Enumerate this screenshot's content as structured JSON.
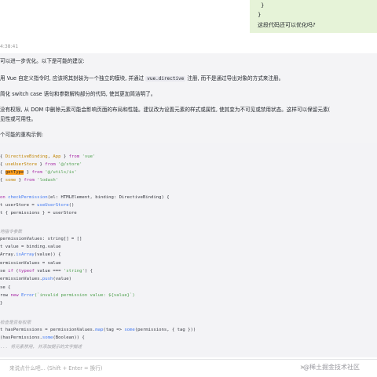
{
  "top_bubble": {
    "lines": [
      "}",
      "}",
      "这段代码还可以优化吗?"
    ]
  },
  "timestamp": "4:38:41",
  "answer": {
    "p1": "可以进一步优化。以下是可能的建议:",
    "p2_pre": "用 Vue 自定义指令时, 应该将其封装为一个独立的模块, 并通过 ",
    "p2_code": "vue.directive",
    "p2_post": " 注册, 而不是通过导出对象的方式来注册。",
    "p3": "简化 switch case 语句和参数解构部分的代码, 使其更加简洁明了。",
    "p4a": "没有权限, 从 DOM 中删除元素可能会影响页面的布局和性能。建议改为设置元素的样式或属性, 使其变为不可见或禁用状态。这样可以保留元素(",
    "p4b": "见性或可用性。",
    "p5": "个可能的重构示例:"
  },
  "code": {
    "l1_pre": "{ ",
    "l1_a": "DirectiveBinding",
    "l1_sep": ", ",
    "l1_b": "App",
    "l1_mid": " } ",
    "l1_kw": "from",
    "l1_str": " 'vue'",
    "l2_pre": "{ ",
    "l2_a": "useUserStore",
    "l2_mid": " } ",
    "l2_kw": "from",
    "l2_str": " '@/store'",
    "l3_pre": "{ ",
    "l3_a": "getType",
    "l3_mid": " } ",
    "l3_kw": "from",
    "l3_str": " '@/utils/is'",
    "l4_pre": "{ ",
    "l4_a": "some",
    "l4_mid": " } ",
    "l4_kw": "from",
    "l4_str": " 'lodash'",
    "l5_kw": "on ",
    "l5_fn": "checkPermission",
    "l5_rest": "(el: HTMLElement, binding: DirectiveBinding) {",
    "l6_pre": "t userStore = ",
    "l6_fn": "useUserStore",
    "l6_post": "()",
    "l7": "t { permissions } = userStore",
    "c1": "地指令参数",
    "l8": "permissionValues: string[] = []",
    "l9": "t value = binding.value",
    "l10_pre": "Array.",
    "l10_fn": "isArray",
    "l10_post": "(value)) {",
    "l11": "ermissionValues = value",
    "l12_pre": "se ",
    "l12_kw": "if",
    "l12_mid": " (",
    "l12_kw2": "typeof",
    "l12_mid2": " value === ",
    "l12_str": "'string'",
    "l12_post": ") {",
    "l13_pre": "ermissionValues.",
    "l13_fn": "push",
    "l13_post": "(value)",
    "l14": "se {",
    "l15_pre": "row ",
    "l15_kw": "new",
    "l15_fn": " Error",
    "l15_str": "(`invalid permission value: ${value}`)",
    "l16": "}",
    "c2": "检查是否有权限",
    "l17_pre": "t hasPermissions = permissionValues.",
    "l17_fn": "map",
    "l17_mid": "(tag => ",
    "l17_fn2": "some",
    "l17_post": "(permissions, { tag }))",
    "l18_pre": "(hasPermissions.",
    "l18_fn": "some",
    "l18_post": "(Boolean)) {",
    "c3": "... 将元素禁用, 并添加提示的文字描述"
  },
  "input": {
    "placeholder": "来说点什么吧... (Shift + Enter = 换行)"
  },
  "send_icon": "send-arrow-icon",
  "watermark": "@稀土掘金技术社区"
}
